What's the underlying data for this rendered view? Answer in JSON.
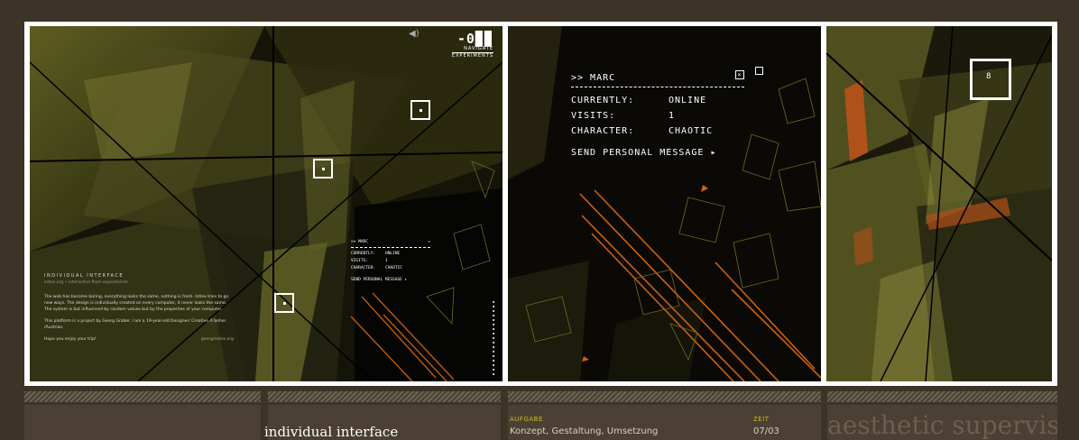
{
  "logo": {
    "mark": "-0▉▉",
    "line1": "NAVIGATE",
    "line2": "EXPERIMENTS"
  },
  "intro": {
    "title": "INDIVIDUAL INTERFACE",
    "subtitle": "intlex.org • interactive flash experiments",
    "para1": "The web has become boring, everything looks the same, nothing is fresh. Intlex tries to go new ways. The design is individually created on every computer, it never looks the same. The system is but influenced by random values but by the properties of your computer.",
    "para2": "This platform is a project by Georg Graber. I am a 19-year-old Designer/ Creative /Flasher /Austrian.",
    "hope": "Hope you enjoy your trip!",
    "site": "georgmetex.org"
  },
  "mini_card": {
    "header": ">> MARC",
    "currently_label": "CURRENTLY:",
    "currently_value": "ONLINE",
    "visits_label": "VISITS:",
    "visits_value": "1",
    "character_label": "CHARACTER:",
    "character_value": "CHAOTIC",
    "send": "SEND PERSONAL MESSAGE ▸"
  },
  "card": {
    "header": ">> MARC",
    "close": "×",
    "currently_label": "CURRENTLY:",
    "currently_value": "ONLINE",
    "visits_label": "VISITS:",
    "visits_value": "1",
    "character_label": "CHARACTER:",
    "character_value": "CHAOTIC",
    "send": "SEND PERSONAL MESSAGE ▸"
  },
  "panel3": {
    "square_label": "8"
  },
  "footer": {
    "title": "individual interface",
    "aufgabe_label": "AUFGABE",
    "aufgabe_value": "Konzept, Gestaltung, Umsetzung",
    "zeit_label": "ZEIT",
    "zeit_value": "07/03",
    "aesthetic": "aesthetic supervision"
  }
}
